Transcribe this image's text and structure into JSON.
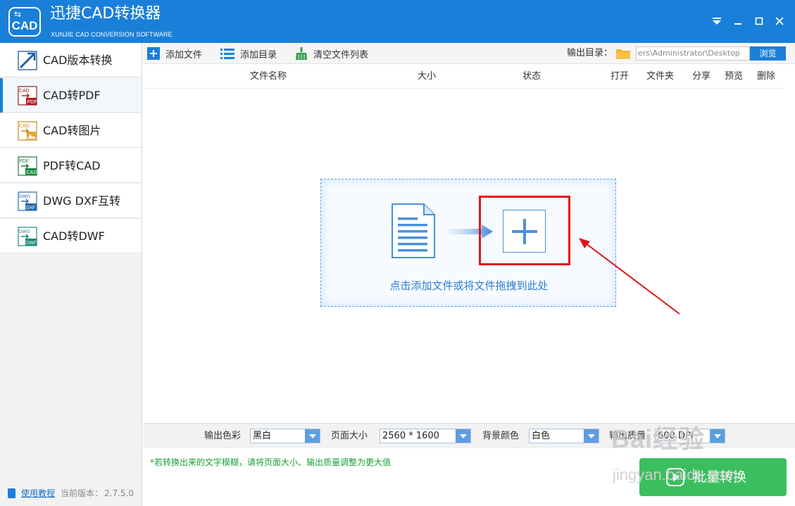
{
  "titlebar": {
    "logo_text": "CAD",
    "title": "迅捷CAD转换器",
    "subtitle": "XUNJIE CAD CONVERSION SOFTWARE",
    "controls": [
      "menu-icon",
      "minimize-icon",
      "maximize-icon",
      "close-icon"
    ]
  },
  "sidebar": {
    "items": [
      {
        "label": "CAD版本转换",
        "icon": "cad-version-icon"
      },
      {
        "label": "CAD转PDF",
        "icon": "cad-pdf-icon",
        "active": true
      },
      {
        "label": "CAD转图片",
        "icon": "cad-image-icon"
      },
      {
        "label": "PDF转CAD",
        "icon": "pdf-cad-icon"
      },
      {
        "label": "DWG DXF互转",
        "icon": "dwg-dxf-icon"
      },
      {
        "label": "CAD转DWF",
        "icon": "cad-dwf-icon"
      }
    ],
    "icon_text": {
      "cad": "CAD",
      "pdf": "PDF",
      "dwg": "DWG",
      "dxf": "DXF",
      "dwf": "DWF"
    },
    "help_link": "使用教程",
    "version_label": "当前版本：",
    "version_value": "2.7.5.0"
  },
  "toolbar": {
    "add_file": "添加文件",
    "add_dir": "添加目录",
    "clear_list": "清空文件列表",
    "output_label": "输出目录：",
    "output_path": "ers\\Administrator\\Desktop",
    "browse": "浏览"
  },
  "table": {
    "columns": {
      "name": "文件名称",
      "size": "大小",
      "status": "状态",
      "open": "打开",
      "folder": "文件夹",
      "share": "分享",
      "preview": "预览",
      "delete": "删除"
    },
    "rows": []
  },
  "drop_zone": {
    "hint": "点击添加文件或将文件拖拽到此处"
  },
  "settings": {
    "color_label": "输出色彩",
    "color_value": "黑白",
    "pagesize_label": "页面大小",
    "pagesize_value": "2560 * 1600",
    "bgcolor_label": "背景颜色",
    "bgcolor_value": "白色",
    "quality_label": "输出质量",
    "quality_value": "600 DPI"
  },
  "footer": {
    "hint": "*若转换出来的文字模糊，请将页面大小、输出质量调整为更大值",
    "convert_button": "批量转换"
  },
  "watermark": {
    "brand": "Bai经验",
    "site": "jingyan.baidu.com"
  },
  "colors": {
    "accent": "#1a7fd8",
    "convert": "#3bbf5e",
    "highlight": "#e0141c",
    "hint_green": "#1aa037"
  }
}
